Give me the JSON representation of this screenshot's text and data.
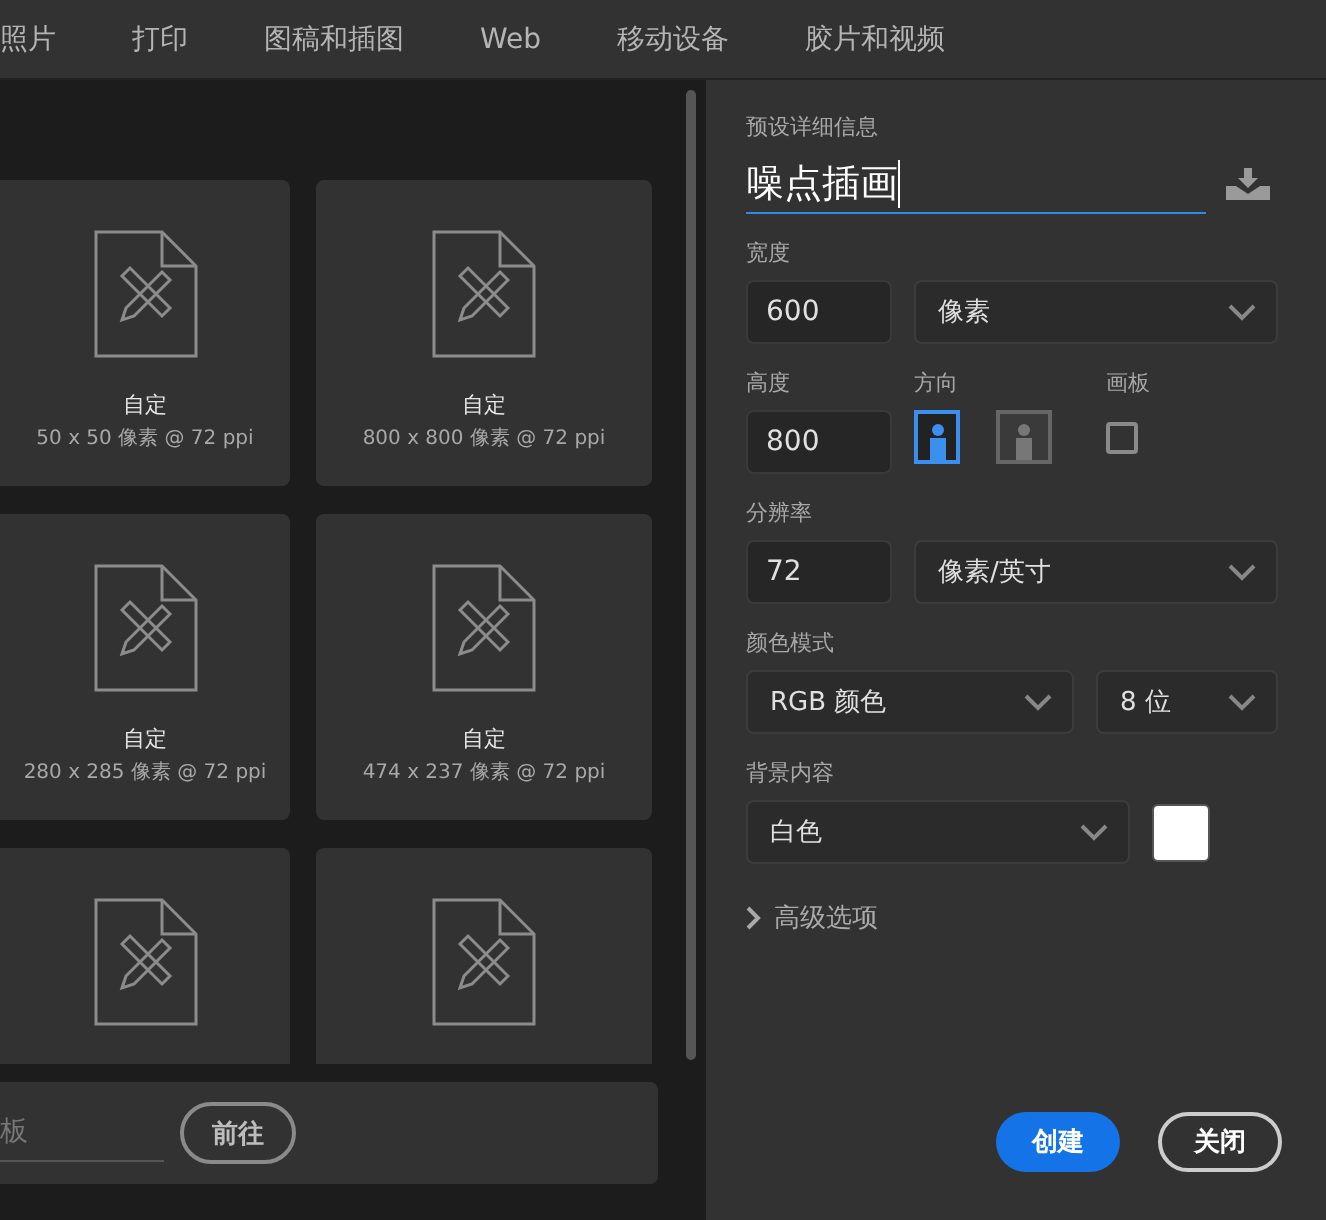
{
  "tabs": [
    {
      "label": "照片"
    },
    {
      "label": "打印"
    },
    {
      "label": "图稿和插图"
    },
    {
      "label": "Web"
    },
    {
      "label": "移动设备"
    },
    {
      "label": "胶片和视频"
    }
  ],
  "presets": [
    {
      "kind": "labeled",
      "title": "自定",
      "size": "50 x 50 像素 @ 72 ppi"
    },
    {
      "kind": "labeled",
      "title": "自定",
      "size": "800 x 800 像素 @ 72 ppi"
    },
    {
      "kind": "labeled",
      "title": "自定",
      "size": "280 x 285 像素 @ 72 ppi"
    },
    {
      "kind": "labeled",
      "title": "自定",
      "size": "474 x 237 像素 @ 72 ppi"
    },
    {
      "kind": "cut"
    },
    {
      "kind": "cut"
    }
  ],
  "template_search": {
    "placeholder": "板",
    "button": "前往"
  },
  "details": {
    "heading": "预设详细信息",
    "name": "噪点插画",
    "width": {
      "label": "宽度",
      "value": "600",
      "unit": "像素"
    },
    "height": {
      "label": "高度",
      "value": "800"
    },
    "orientation": {
      "label": "方向",
      "options": [
        {
          "kind": "portrait",
          "selected": true
        },
        {
          "kind": "landscape",
          "selected": false
        }
      ]
    },
    "artboard": {
      "label": "画板",
      "checked": false
    },
    "resolution": {
      "label": "分辨率",
      "value": "72",
      "unit": "像素/英寸"
    },
    "color_mode": {
      "label": "颜色模式",
      "mode": "RGB 颜色",
      "depth": "8 位"
    },
    "background": {
      "label": "背景内容",
      "value": "白色",
      "color": "#ffffff"
    },
    "advanced": {
      "label": "高级选项",
      "expanded": false
    }
  },
  "buttons": [
    {
      "label": "创建",
      "kind": "primary"
    },
    {
      "label": "关闭",
      "kind": "secondary"
    }
  ]
}
